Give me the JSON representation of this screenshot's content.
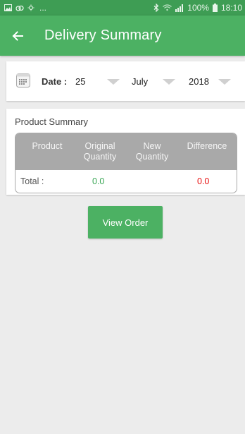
{
  "status_bar": {
    "notif_icons": [
      "image-icon",
      "cloud-icon",
      "weather-icon"
    ],
    "ellipsis": "...",
    "battery": "100%",
    "time": "18:10"
  },
  "app_bar": {
    "title": "Delivery Summary",
    "back_icon": "arrow-left-icon"
  },
  "date_picker": {
    "label": "Date :",
    "day": "25",
    "month": "July",
    "year": "2018"
  },
  "product_summary": {
    "title": "Product Summary",
    "headers": {
      "product": "Product",
      "original_l1": "Original",
      "original_l2": "Quantity",
      "new_l1": "New",
      "new_l2": "Quantity",
      "difference": "Difference"
    },
    "total_row": {
      "label": "Total :",
      "original": "0.0",
      "difference": "0.0"
    }
  },
  "colors": {
    "primary": "#4cb163",
    "status_bar": "#3e9d54",
    "table_header": "#a9a9a9",
    "positive": "#3aa655",
    "negative": "#e81010"
  },
  "actions": {
    "view_order": "View Order"
  }
}
